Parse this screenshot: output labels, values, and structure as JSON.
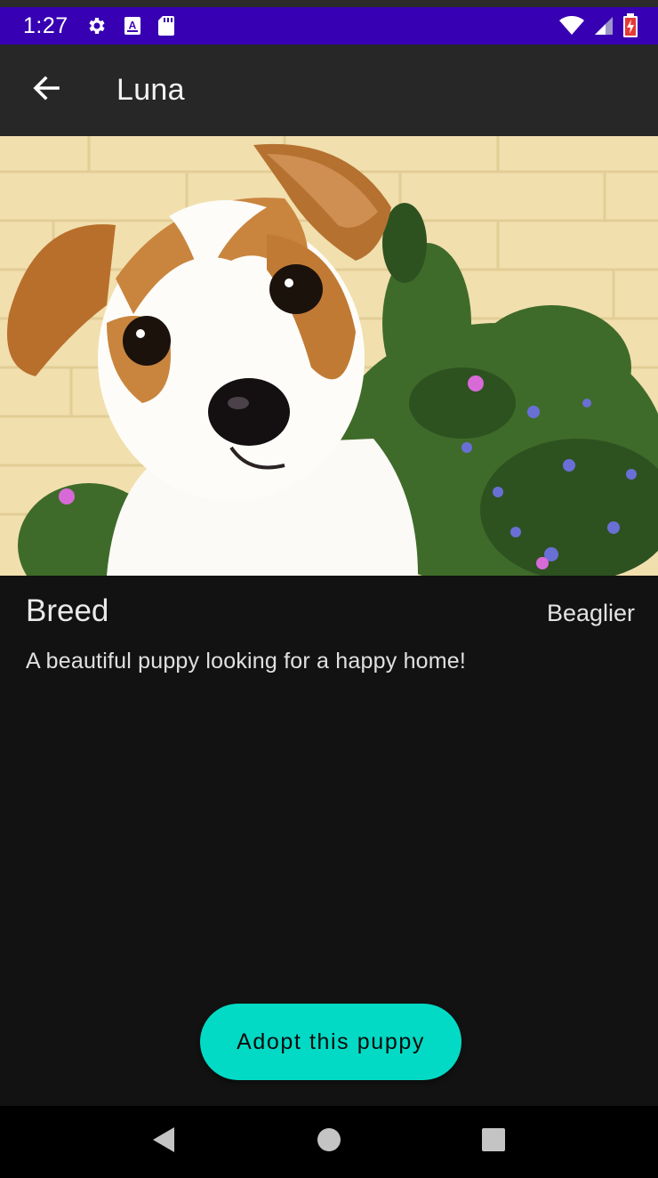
{
  "status_bar": {
    "time": "1:27",
    "left_icons": [
      "gear-icon",
      "a-font-icon",
      "sd-card-icon"
    ],
    "right_icons": [
      "wifi-icon",
      "signal-icon",
      "battery-charging-icon"
    ],
    "background_color": "#3700b3"
  },
  "app_bar": {
    "title": "Luna",
    "back_icon": "arrow-back-icon"
  },
  "hero": {
    "subject": "puppy photo"
  },
  "details": {
    "breed_label": "Breed",
    "breed_value": "Beaglier",
    "description": "A beautiful puppy looking for a happy home!"
  },
  "actions": {
    "adopt_label": "Adopt this puppy",
    "accent_color": "#03dac5"
  },
  "nav_bar": {
    "buttons": [
      "back-triangle-icon",
      "home-circle-icon",
      "recents-square-icon"
    ]
  }
}
